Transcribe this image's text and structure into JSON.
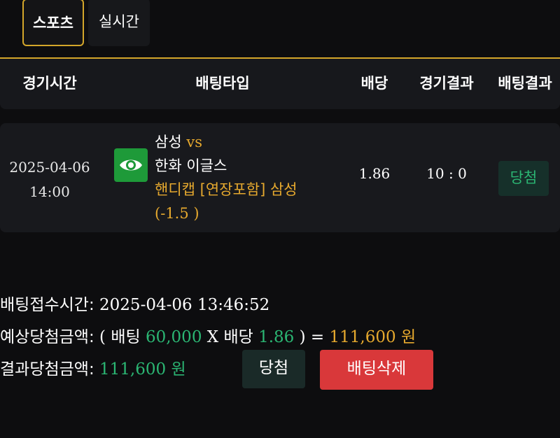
{
  "tabs": {
    "sports": "스포츠",
    "live": "실시간"
  },
  "colors": {
    "accent": "#d4a62a",
    "win": "#2bb673",
    "danger": "#d9383a",
    "watch": "#1e9a39"
  },
  "table": {
    "headers": {
      "time": "경기시간",
      "bet_type": "배팅타입",
      "odds": "배당",
      "game_result": "경기결과",
      "bet_result": "배팅결과"
    },
    "row": {
      "date": "2025-04-06",
      "time": "14:00",
      "watch_icon": "eye-icon",
      "home_team": "삼성",
      "vs": "vs",
      "away_team": "한화 이글스",
      "pick": "핸디캡 [연장포함] 삼성",
      "handicap": "(-1.5 )",
      "odds": "1.86",
      "score": "10 : 0",
      "result": "당첨"
    }
  },
  "summary": {
    "received_label": "배팅접수시간:",
    "received_value": "2025-04-06 13:46:52",
    "expected_label": "예상당첨금액:",
    "open_paren": "(",
    "stake_label": "배팅",
    "stake": "60,000",
    "times": "X",
    "odds_label": "배당",
    "odds": "1.86",
    "close_eq": ") =",
    "expected_amount": "111,600",
    "currency": "원",
    "result_label": "결과당첨금액:",
    "result_amount": "111,600",
    "result_currency": "원",
    "win_button": "당첨",
    "delete_button": "배팅삭제"
  }
}
